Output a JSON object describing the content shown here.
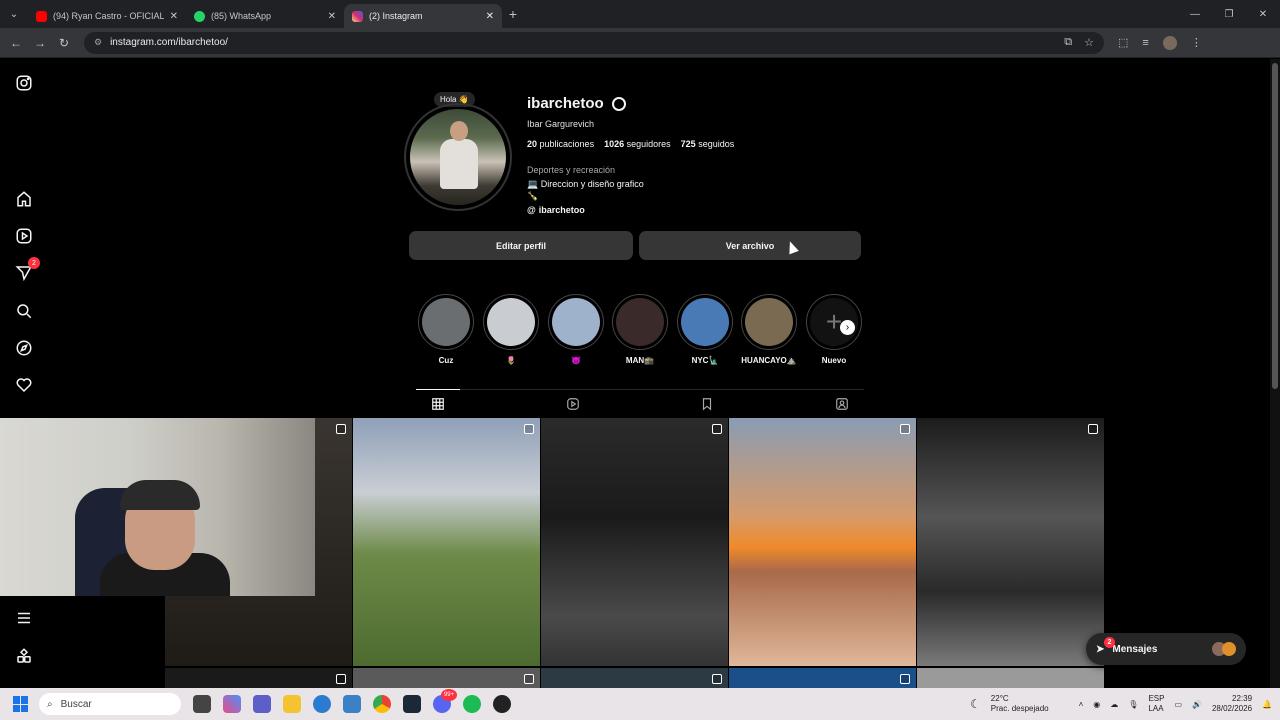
{
  "browser": {
    "tabs": [
      {
        "title": "(94) Ryan Castro - OFICIAL (Vis",
        "color": "#ff0000"
      },
      {
        "title": "(85) WhatsApp",
        "color": "#25d366"
      },
      {
        "title": "(2) Instagram",
        "color": "#e1306c"
      }
    ],
    "url": "instagram.com/ibarchetoo/"
  },
  "sidenav": {
    "notifications_badge": "2"
  },
  "profile": {
    "note": "Hola 👋",
    "username": "ibarchetoo",
    "full_name": "Ibar Gargurevich",
    "stats": {
      "posts_count": "20",
      "posts_label": "publicaciones",
      "followers_count": "1026",
      "followers_label": "seguidores",
      "following_count": "725",
      "following_label": "seguidos"
    },
    "category": "Deportes y recreación",
    "bio_line1": "💻 Direccion y diseño grafico",
    "bio_line2": "🍾",
    "threads_handle": "ibarchetoo",
    "edit_button": "Editar perfil",
    "archive_button": "Ver archivo"
  },
  "highlights": [
    {
      "label": "Cuz",
      "color": "#6b6e70"
    },
    {
      "label": "🌷",
      "color": "#c9ccd0"
    },
    {
      "label": "👿",
      "color": "#9fb2cc"
    },
    {
      "label": "MAN🕋",
      "color": "#3b2a2a"
    },
    {
      "label": "NYC🗽",
      "color": "#4a7ab5"
    },
    {
      "label": "HUANCAYO⛰️",
      "color": "#7b6a52"
    },
    {
      "label": "Nuevo",
      "color": "#121212"
    }
  ],
  "messages": {
    "label": "Mensajes",
    "badge": "2"
  },
  "taskbar": {
    "search_placeholder": "Buscar",
    "weather_temp": "22°C",
    "weather_desc": "Prac. despejado",
    "lang": "ESP",
    "lang2": "LAA",
    "time": "22:39",
    "date": "28/02/2026",
    "discord_badge": "99+"
  }
}
